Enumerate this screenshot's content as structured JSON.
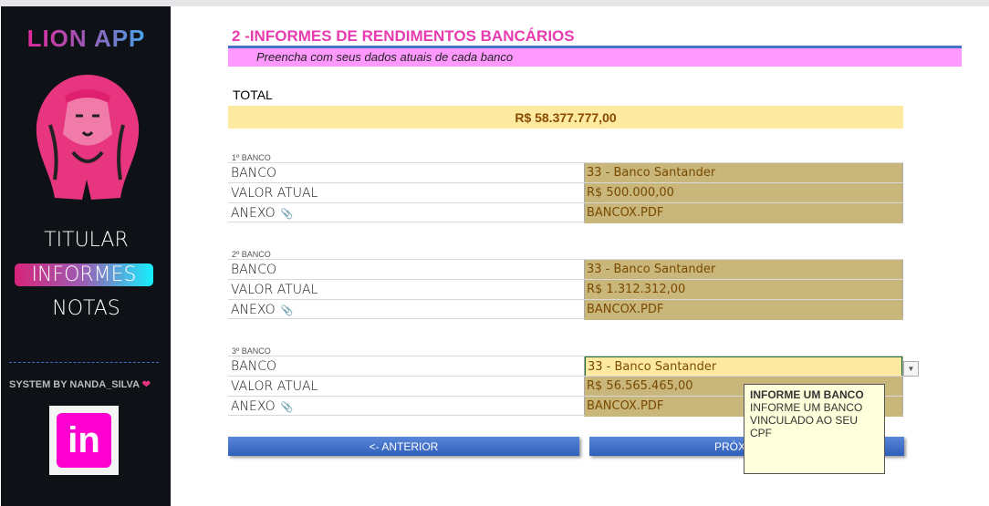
{
  "sidebar": {
    "app_title": "LION APP",
    "nav": [
      {
        "label": "TITULAR"
      },
      {
        "label": "INFORMES",
        "active": true
      },
      {
        "label": "NOTAS"
      }
    ],
    "credit": "SYSTEM BY NANDA_SILVA",
    "linkedin": "in"
  },
  "header": {
    "title": "2 -INFORMES DE RENDIMENTOS BANCÁRIOS",
    "subtitle": "Preencha com seus dados atuais de cada banco"
  },
  "total": {
    "label": "TOTAL",
    "value": "R$ 58.377.777,00"
  },
  "row_labels": {
    "banco": "BANCO",
    "valor": "VALOR ATUAL",
    "anexo": "ANEXO"
  },
  "banks": [
    {
      "label": "1º BANCO",
      "banco": "33 - Banco Santander",
      "valor": "R$ 500.000,00",
      "anexo": "BANCOX.PDF"
    },
    {
      "label": "2º BANCO",
      "banco": "33 - Banco Santander",
      "valor": "R$ 1.312.312,00",
      "anexo": "BANCOX.PDF"
    },
    {
      "label": "3º BANCO",
      "banco": "33 - Banco Santander",
      "valor": "R$ 56.565.465,00",
      "anexo": "BANCOX.PDF"
    }
  ],
  "buttons": {
    "prev": "<- ANTERIOR",
    "next": "PRÓXIMO ->"
  },
  "tooltip": {
    "title": "INFORME UM BANCO",
    "line1": "INFORME UM BANCO",
    "line2": "VINCULADO AO SEU CPF"
  },
  "colors": {
    "accent": "#e83bb0",
    "band": "#ff99ff",
    "total_bg": "#fde9a0",
    "cell": "#c8b67a"
  }
}
